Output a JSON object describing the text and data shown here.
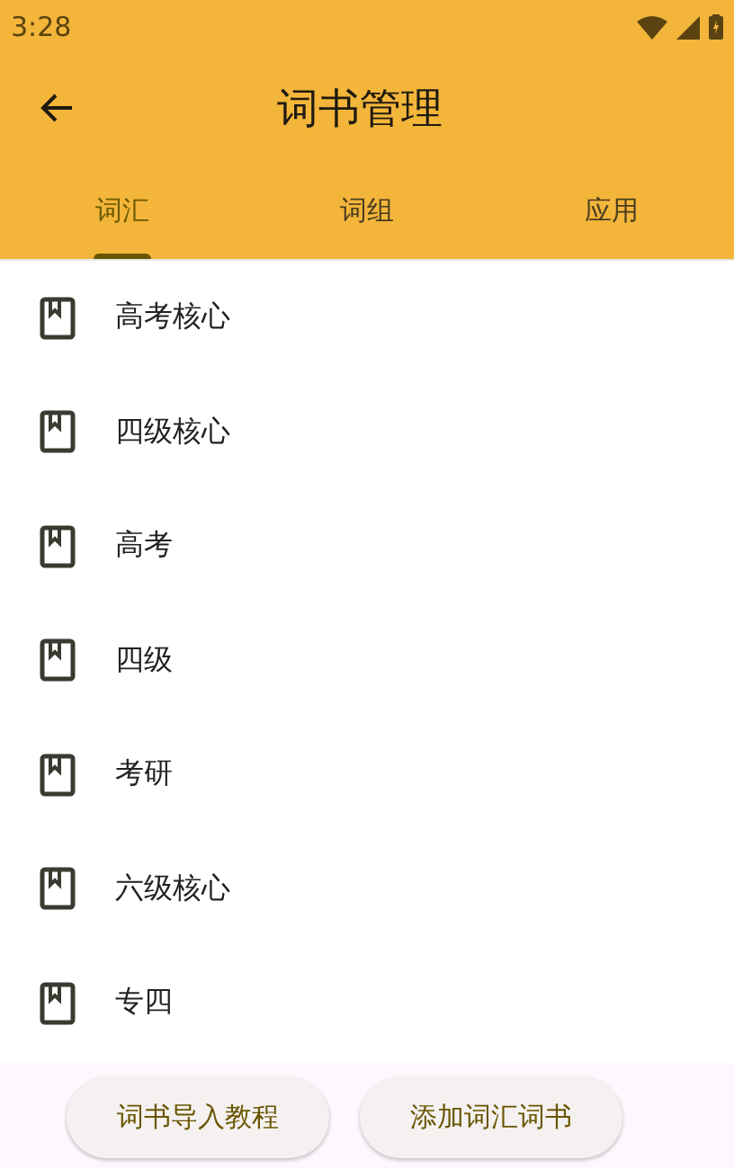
{
  "status_bar": {
    "time": "3:28"
  },
  "app_bar": {
    "title": "词书管理"
  },
  "tabs": [
    {
      "label": "词汇",
      "selected": true
    },
    {
      "label": "词组",
      "selected": false
    },
    {
      "label": "应用",
      "selected": false
    }
  ],
  "books": [
    {
      "name": "高考核心"
    },
    {
      "name": "四级核心"
    },
    {
      "name": "高考"
    },
    {
      "name": "四级"
    },
    {
      "name": "考研"
    },
    {
      "name": "六级核心"
    },
    {
      "name": "专四"
    }
  ],
  "buttons": [
    {
      "label": "词书导入教程"
    },
    {
      "label": "添加词汇词书"
    }
  ]
}
